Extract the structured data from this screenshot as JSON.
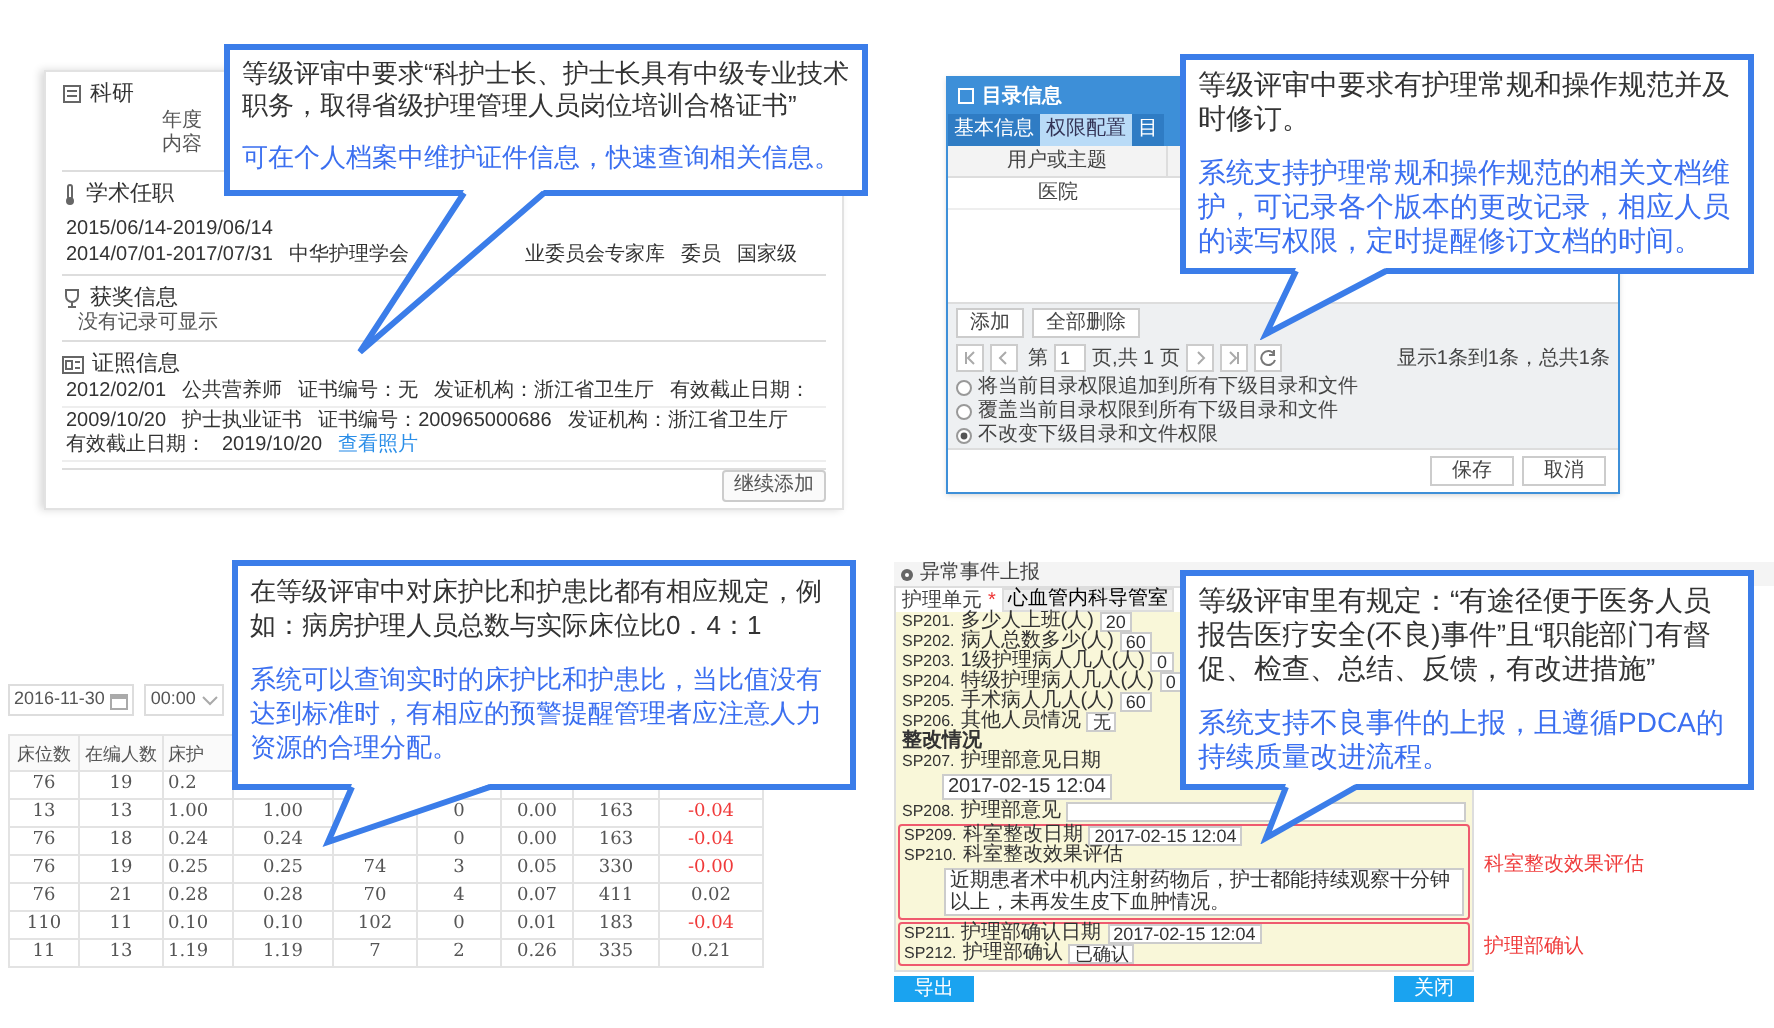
{
  "profile_panel": {
    "callout": {
      "requirement": "等级评审中要求“科护士长、护士长具有中级专业技术职务，取得省级护理管理人员岗位培训合格证书”",
      "feature": "可在个人档案中维护证件信息，快速查询相关信息。"
    },
    "sections": [
      {
        "kind": "research",
        "title": "科研",
        "lines": [
          "年度",
          "内容"
        ]
      },
      {
        "kind": "academic",
        "title": "学术任职",
        "rows": [
          {
            "parts": [
              "2015/06/14-2019/06/14"
            ]
          },
          {
            "parts": [
              "2014/07/01-2017/07/31",
              "中华护理学会",
              "业委员会专家库",
              "委员",
              "国家级"
            ]
          }
        ]
      },
      {
        "kind": "award",
        "title": "获奖信息",
        "lines": [
          "没有记录可显示"
        ]
      },
      {
        "kind": "certificate",
        "title": "证照信息",
        "rows": [
          {
            "parts": [
              "2012/02/01",
              "公共营养师",
              "证书编号：无",
              "发证机构：浙江省卫生厅",
              "有效截止日期："
            ]
          },
          {
            "parts": [
              "2009/10/20",
              "护士执业证书",
              "证书编号：200965000686",
              "发证机构：浙江省卫生厅",
              "有效截止日期：",
              "2019/10/20"
            ],
            "link": "查看照片"
          }
        ]
      }
    ],
    "add_button": "继续添加"
  },
  "directory_dialog": {
    "callout": {
      "requirement": "等级评审中要求有护理常规和操作规范并及时修订。",
      "feature": "系统支持护理常规和操作规范的相关文档维护，可记录各个版本的更改记录，相应人员的读写权限，定时提醒修订文档的时间。"
    },
    "title": "目录信息",
    "tabs": [
      {
        "label": "基本信息",
        "selected": false
      },
      {
        "label": "权限配置",
        "selected": true
      },
      {
        "label": "目",
        "selected": false
      }
    ],
    "table": {
      "column": "用户或主题",
      "rows": [
        "医院"
      ]
    },
    "buttons": [
      "添加",
      "全部删除"
    ],
    "pager": {
      "page_prefix": "第",
      "page": "1",
      "page_suffix": "页,共 1 页",
      "summary": "显示1条到1条，总共1条"
    },
    "options": [
      {
        "label": "将当前目录权限追加到所有下级目录和文件",
        "selected": false
      },
      {
        "label": "覆盖当前目录权限到所有下级目录和文件",
        "selected": false
      },
      {
        "label": "不改变下级目录和文件权限",
        "selected": true
      }
    ],
    "footer_buttons": [
      "保存",
      "取消"
    ]
  },
  "ratio_table": {
    "callout": {
      "requirement": "在等级评审中对床护比和护患比都有相应规定，例如：病房护理人员总数与实际床位比0．4：1",
      "feature": "系统可以查询实时的床护比和护患比，当比值没有达到标准时，有相应的预警提醒管理者应注意人力资源的合理分配。"
    },
    "date": "2016-11-30",
    "time": "00:00",
    "columns": [
      "床位数",
      "在编人数",
      "床护",
      null,
      null,
      null,
      null,
      null,
      null
    ],
    "rows": [
      {
        "cells": [
          "76",
          "19",
          "0.2",
          null,
          null,
          null,
          null,
          null,
          null
        ]
      },
      {
        "cells": [
          "13",
          "13",
          "1.00",
          "1.00",
          null,
          "0",
          "0.00",
          "163",
          "-0.04"
        ],
        "alert": true
      },
      {
        "cells": [
          "76",
          "18",
          "0.24",
          "0.24",
          null,
          "0",
          "0.00",
          "163",
          "-0.04"
        ],
        "alert": true
      },
      {
        "cells": [
          "76",
          "19",
          "0.25",
          "0.25",
          "74",
          "3",
          "0.05",
          "330",
          "-0.00"
        ],
        "alert": true
      },
      {
        "cells": [
          "76",
          "21",
          "0.28",
          "0.28",
          "70",
          "4",
          "0.07",
          "411",
          "0.02"
        ],
        "alert": false
      },
      {
        "cells": [
          "110",
          "11",
          "0.10",
          "0.10",
          "102",
          "0",
          "0.01",
          "183",
          "-0.04"
        ],
        "alert": true
      },
      {
        "cells": [
          "11",
          "13",
          "1.19",
          "1.19",
          "7",
          "2",
          "0.26",
          "335",
          "0.21"
        ],
        "alert": false
      }
    ]
  },
  "event_form": {
    "callout": {
      "requirement": "等级评审里有规定：“有途径便于医务人员报告医疗安全(不良)事件”且“职能部门有督促、检查、总结、反馈，有改进措施”",
      "feature": "系统支持不良事件的上报，且遵循PDCA的持续质量改进流程。"
    },
    "title": "异常事件上报",
    "unit": {
      "label": "护理单元",
      "required_mark": "*",
      "value": "心血管内科导管室"
    },
    "rows": [
      {
        "kind": "inline",
        "code": "SP201.",
        "label": "多少人上班(人)",
        "value": "20"
      },
      {
        "kind": "inline",
        "code": "SP202.",
        "label": "病人总数多少(人)",
        "value": "60"
      },
      {
        "kind": "inline",
        "code": "SP203.",
        "label": "1级护理病人几人(人)",
        "value": "0"
      },
      {
        "kind": "inline",
        "code": "SP204.",
        "label": "特级护理病人几人(人)",
        "value": "0"
      },
      {
        "kind": "inline",
        "code": "SP205.",
        "label": "手术病人几人(人)",
        "value": "60"
      },
      {
        "kind": "inline",
        "code": "SP206.",
        "label": "其他人员情况",
        "value": "无"
      },
      {
        "kind": "heading",
        "label": "整改情况"
      },
      {
        "kind": "stacked",
        "code": "SP207.",
        "label": "护理部意见日期",
        "value": "2017-02-15 12:04"
      },
      {
        "kind": "inline",
        "code": "SP208.",
        "label": "护理部意见"
      }
    ],
    "groups": [
      {
        "note": "科室整改效果评估",
        "rows": [
          {
            "kind": "inline",
            "code": "SP209.",
            "label": "科室整改日期",
            "value": "2017-02-15 12:04"
          },
          {
            "kind": "stacked",
            "code": "SP210.",
            "label": "科室整改效果评估",
            "value": "近期患者术中机内注射药物后，护士都能持续观察十分钟以上，未再发生皮下血肿情况。"
          }
        ]
      },
      {
        "note": "护理部确认",
        "rows": [
          {
            "kind": "inline",
            "code": "SP211.",
            "label": "护理部确认日期",
            "value": "2017-02-15 12:04"
          },
          {
            "kind": "inline",
            "code": "SP212.",
            "label": "护理部确认",
            "value": "已确认"
          }
        ]
      }
    ],
    "buttons": [
      "导出",
      "关闭"
    ]
  }
}
